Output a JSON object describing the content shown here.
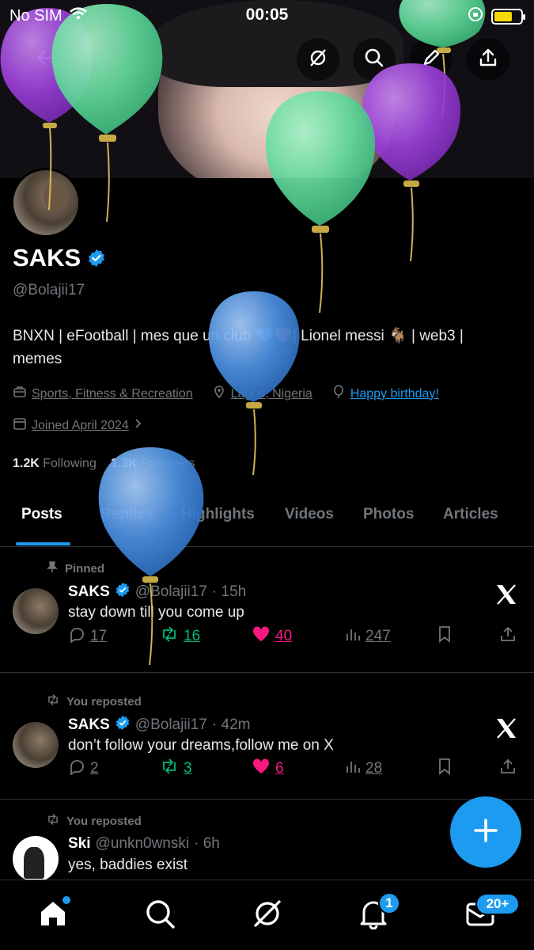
{
  "status_bar": {
    "carrier": "No SIM",
    "time": "00:05"
  },
  "header": {
    "back_icon": "arrow-left-icon",
    "actions": [
      "grok-icon",
      "search-icon",
      "edit-icon",
      "share-icon"
    ]
  },
  "profile": {
    "name": "SAKS",
    "handle": "@Bolajii17",
    "bio_line1": "BNXN | eFootball | mes que un club 💙❤️| Lionel messi 🐐 | web3 |",
    "bio_line2": "memes",
    "category": "Sports, Fitness & Recreation",
    "location": "Lagos, Nigeria",
    "birthday": "Happy birthday!",
    "joined": "Joined April 2024",
    "following_count": "1.2K",
    "following_label": "Following",
    "followers_count": "1.3K",
    "followers_label": "Followers"
  },
  "tabs": [
    "Posts",
    "Replies",
    "Highlights",
    "Videos",
    "Photos",
    "Articles"
  ],
  "posts": [
    {
      "context": "Pinned",
      "name": "SAKS",
      "handle": "@Bolajii17",
      "time": "· 15h",
      "text": "stay down till you come up",
      "replies": "17",
      "reposts": "16",
      "likes": "40",
      "views": "247"
    },
    {
      "context": "You reposted",
      "name": "SAKS",
      "handle": "@Bolajii17",
      "time": "· 42m",
      "text": "don’t follow your dreams,follow me on X",
      "replies": "2",
      "reposts": "3",
      "likes": "6",
      "views": "28"
    },
    {
      "context": "You reposted",
      "name": "Ski",
      "handle": "@unkn0wnski",
      "time": "· 6h",
      "text": "yes, baddies exist"
    }
  ],
  "bottom_nav": {
    "items": [
      "home-icon",
      "search-icon",
      "grok-icon",
      "notifications-icon",
      "messages-icon"
    ],
    "notifications_badge": "1",
    "messages_badge": "20+"
  },
  "colors": {
    "accent": "#1d9bf0",
    "repost": "#00ba7c",
    "like": "#f91880",
    "balloon_green": "#5fd89a",
    "balloon_purple": "#9b3fd9",
    "balloon_blue": "#4a90e2"
  }
}
